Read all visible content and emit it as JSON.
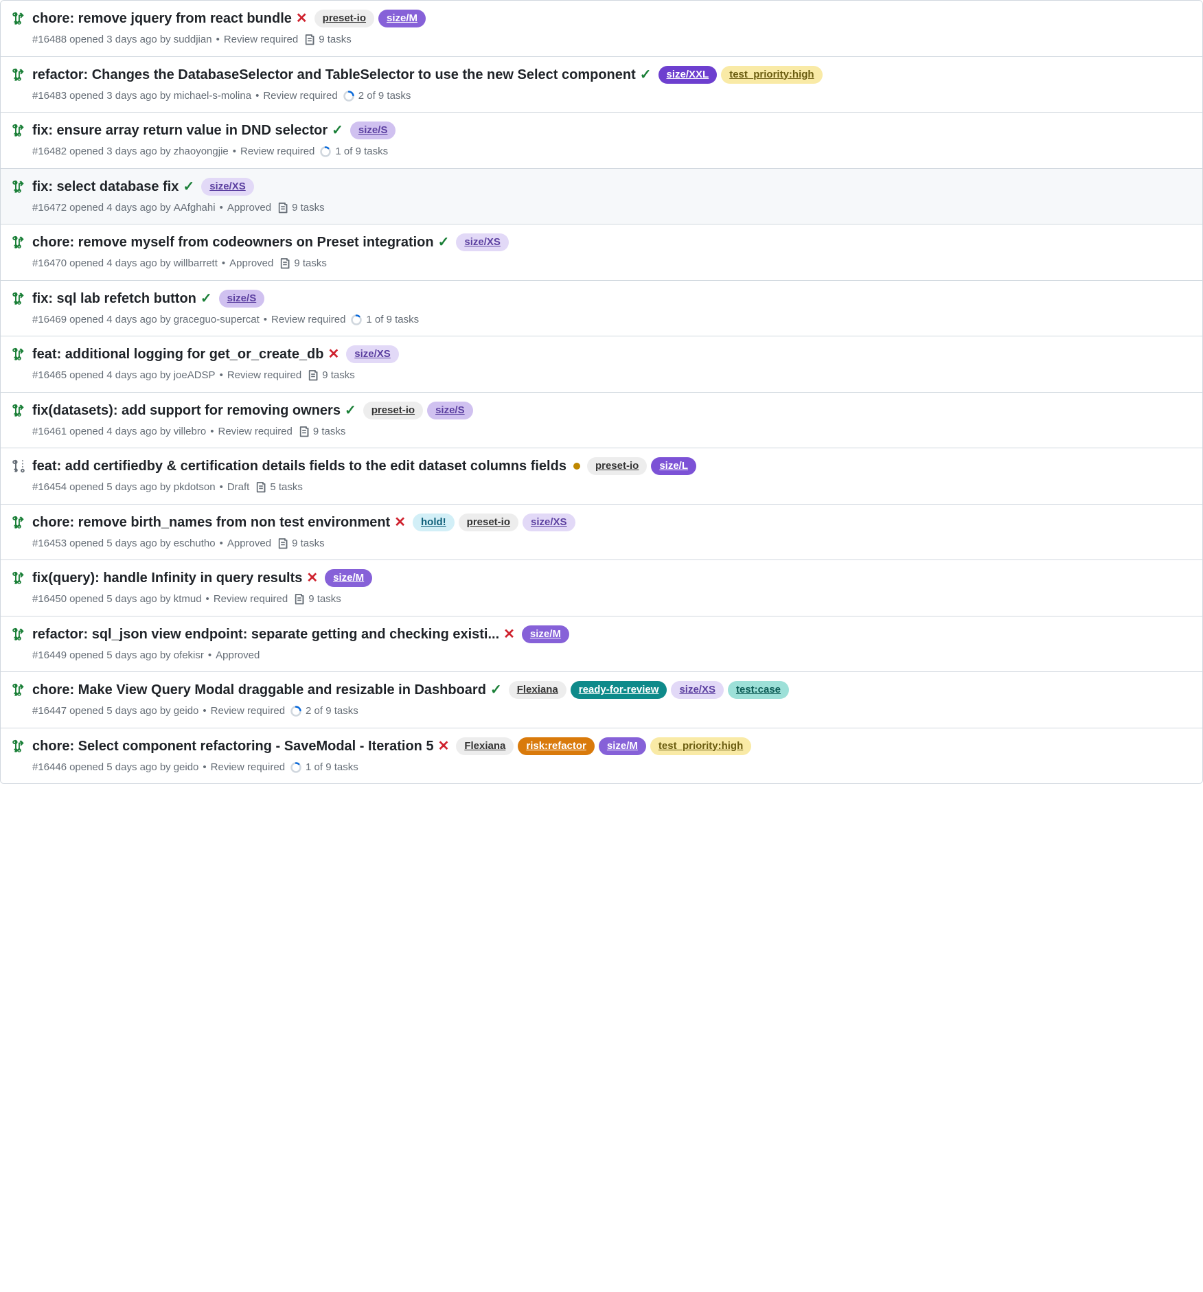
{
  "label_colors": {
    "preset-io": {
      "bg": "#ededed",
      "fg": "#333333"
    },
    "Flexiana": {
      "bg": "#ededed",
      "fg": "#333333"
    },
    "hold!": {
      "bg": "#d2eff7",
      "fg": "#10607a"
    },
    "ready-for-review": {
      "bg": "#0e8a8a",
      "fg": "#ffffff"
    },
    "test:case": {
      "bg": "#9de0d8",
      "fg": "#0b5a54"
    },
    "risk:refactor": {
      "bg": "#d97a0b",
      "fg": "#ffffff"
    },
    "size/XS": {
      "bg": "#e2d9f7",
      "fg": "#5b3fa0"
    },
    "size/S": {
      "bg": "#d0c1f0",
      "fg": "#5b3fa0"
    },
    "size/M": {
      "bg": "#8661d8",
      "fg": "#ffffff"
    },
    "size/L": {
      "bg": "#7c52d6",
      "fg": "#ffffff"
    },
    "size/XXL": {
      "bg": "#6d3fcf",
      "fg": "#ffffff"
    },
    "test_priority:high": {
      "bg": "#f9eaa6",
      "fg": "#6b5d10"
    }
  },
  "prs": [
    {
      "title": "chore: remove jquery from react bundle",
      "status": "fail",
      "labels": [
        "preset-io",
        "size/M"
      ],
      "number": "#16488",
      "opened": "3 days ago",
      "author": "suddjian",
      "review": "Review required",
      "tasks": {
        "type": "list",
        "text": "9 tasks"
      },
      "icon": "open",
      "highlight": false
    },
    {
      "title": "refactor: Changes the DatabaseSelector and TableSelector to use the new Select component",
      "status": "success",
      "labels": [
        "size/XXL",
        "test_priority:high"
      ],
      "number": "#16483",
      "opened": "3 days ago",
      "author": "michael-s-molina",
      "review": "Review required",
      "tasks": {
        "type": "progress",
        "done": 2,
        "total": 9,
        "text": "2 of 9 tasks"
      },
      "icon": "open",
      "highlight": false
    },
    {
      "title": "fix: ensure array return value in DND selector",
      "status": "success",
      "labels": [
        "size/S"
      ],
      "number": "#16482",
      "opened": "3 days ago",
      "author": "zhaoyongjie",
      "review": "Review required",
      "tasks": {
        "type": "progress",
        "done": 1,
        "total": 9,
        "text": "1 of 9 tasks"
      },
      "icon": "open",
      "highlight": false
    },
    {
      "title": "fix: select database fix",
      "status": "success",
      "labels": [
        "size/XS"
      ],
      "number": "#16472",
      "opened": "4 days ago",
      "author": "AAfghahi",
      "review": "Approved",
      "tasks": {
        "type": "list",
        "text": "9 tasks"
      },
      "icon": "open",
      "highlight": true
    },
    {
      "title": "chore: remove myself from codeowners on Preset integration",
      "status": "success",
      "labels": [
        "size/XS"
      ],
      "number": "#16470",
      "opened": "4 days ago",
      "author": "willbarrett",
      "review": "Approved",
      "tasks": {
        "type": "list",
        "text": "9 tasks"
      },
      "icon": "open",
      "highlight": false
    },
    {
      "title": "fix: sql lab refetch button",
      "status": "success",
      "labels": [
        "size/S"
      ],
      "number": "#16469",
      "opened": "4 days ago",
      "author": "graceguo-supercat",
      "review": "Review required",
      "tasks": {
        "type": "progress",
        "done": 1,
        "total": 9,
        "text": "1 of 9 tasks"
      },
      "icon": "open",
      "highlight": false
    },
    {
      "title": "feat: additional logging for get_or_create_db",
      "status": "fail",
      "labels": [
        "size/XS"
      ],
      "number": "#16465",
      "opened": "4 days ago",
      "author": "joeADSP",
      "review": "Review required",
      "tasks": {
        "type": "list",
        "text": "9 tasks"
      },
      "icon": "open",
      "highlight": false
    },
    {
      "title": "fix(datasets): add support for removing owners",
      "status": "success",
      "labels": [
        "preset-io",
        "size/S"
      ],
      "number": "#16461",
      "opened": "4 days ago",
      "author": "villebro",
      "review": "Review required",
      "tasks": {
        "type": "list",
        "text": "9 tasks"
      },
      "icon": "open",
      "highlight": false
    },
    {
      "title": "feat: add certifiedby & certification details fields to the edit dataset columns fields",
      "status": "pending",
      "labels": [
        "preset-io",
        "size/L"
      ],
      "number": "#16454",
      "opened": "5 days ago",
      "author": "pkdotson",
      "review": "Draft",
      "tasks": {
        "type": "list",
        "text": "5 tasks"
      },
      "icon": "draft",
      "highlight": false
    },
    {
      "title": "chore: remove birth_names from non test environment",
      "status": "fail",
      "labels": [
        "hold!",
        "preset-io",
        "size/XS"
      ],
      "number": "#16453",
      "opened": "5 days ago",
      "author": "eschutho",
      "review": "Approved",
      "tasks": {
        "type": "list",
        "text": "9 tasks"
      },
      "icon": "open",
      "highlight": false
    },
    {
      "title": "fix(query): handle Infinity in query results",
      "status": "fail",
      "labels": [
        "size/M"
      ],
      "number": "#16450",
      "opened": "5 days ago",
      "author": "ktmud",
      "review": "Review required",
      "tasks": {
        "type": "list",
        "text": "9 tasks"
      },
      "icon": "open",
      "highlight": false
    },
    {
      "title": "refactor: sql_json view endpoint: separate getting and checking existi...",
      "status": "fail",
      "labels": [
        "size/M"
      ],
      "number": "#16449",
      "opened": "5 days ago",
      "author": "ofekisr",
      "review": "Approved",
      "tasks": null,
      "icon": "open",
      "highlight": false
    },
    {
      "title": "chore: Make View Query Modal draggable and resizable in Dashboard",
      "status": "success",
      "labels": [
        "Flexiana",
        "ready-for-review",
        "size/XS",
        "test:case"
      ],
      "number": "#16447",
      "opened": "5 days ago",
      "author": "geido",
      "review": "Review required",
      "tasks": {
        "type": "progress",
        "done": 2,
        "total": 9,
        "text": "2 of 9 tasks"
      },
      "icon": "open",
      "highlight": false
    },
    {
      "title": "chore: Select component refactoring - SaveModal - Iteration 5",
      "status": "fail",
      "labels": [
        "Flexiana",
        "risk:refactor",
        "size/M",
        "test_priority:high"
      ],
      "number": "#16446",
      "opened": "5 days ago",
      "author": "geido",
      "review": "Review required",
      "tasks": {
        "type": "progress",
        "done": 1,
        "total": 9,
        "text": "1 of 9 tasks"
      },
      "icon": "open",
      "highlight": false
    }
  ]
}
